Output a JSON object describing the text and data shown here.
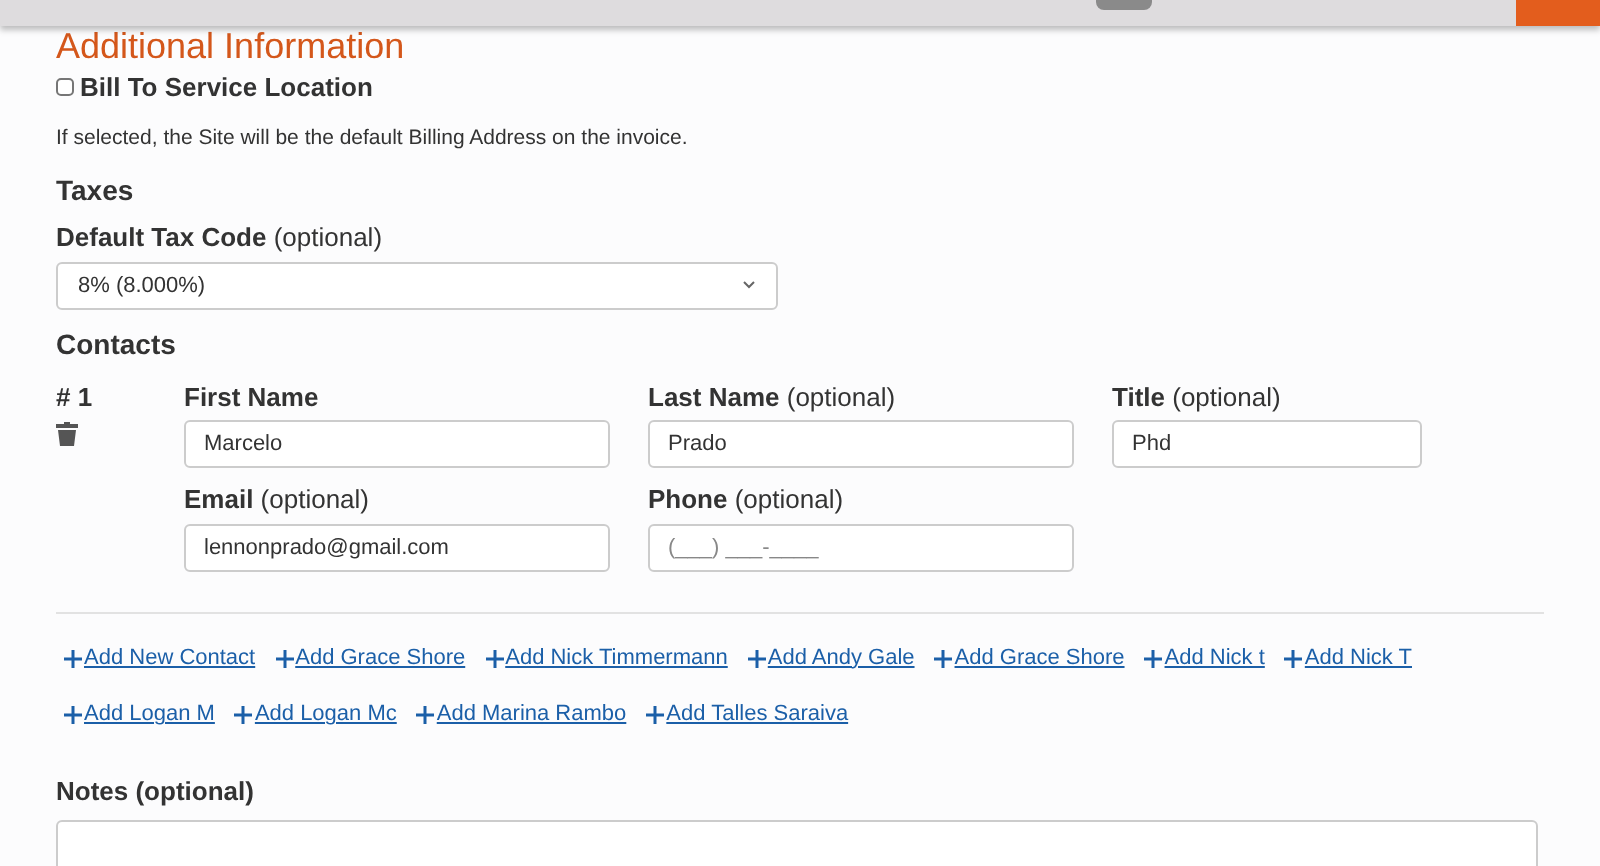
{
  "section_title": "Additional Information",
  "bill_to_service": {
    "label": "Bill To Service Location",
    "checked": false,
    "help": "If selected, the Site will be the default Billing Address on the invoice."
  },
  "taxes": {
    "heading": "Taxes",
    "tax_code": {
      "label": "**Default Tax Code** (optional)",
      "value": "8% (8.000%)"
    }
  },
  "contacts": {
    "heading": "Contacts",
    "items": [
      {
        "number": "# 1",
        "fields": [
          {
            "label": "First Name",
            "value": "Marcelo"
          },
          {
            "label": "**Last Name** (optional)",
            "value": "Prado"
          },
          {
            "label": "**Title** (optional)",
            "value": "Phd"
          },
          {
            "label": "**Email** (optional)",
            "value": "lennonprado@gmail.com"
          },
          {
            "label": "**Phone** (optional)",
            "placeholder": "(___) ___-____"
          }
        ]
      }
    ],
    "add_links": [
      "Add New Contact",
      "Add Grace Shore",
      "Add Nick Timmermann",
      "Add Andy Gale",
      "Add Grace Shore",
      "Add Nick t",
      "Add Nick T",
      "Add Logan M",
      "Add Logan Mc",
      "Add Marina Rambo",
      "Add Talles Saraiva"
    ]
  },
  "notes": {
    "label": "Notes (optional)"
  }
}
